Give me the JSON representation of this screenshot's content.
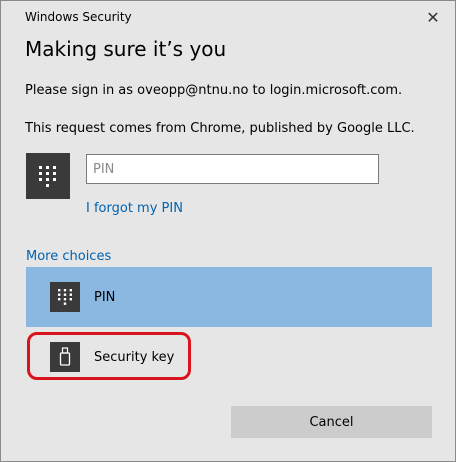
{
  "window": {
    "title": "Windows Security",
    "close_glyph": "✕"
  },
  "heading": "Making sure it’s you",
  "message": {
    "signin": "Please sign in as oveopp@ntnu.no to login.microsoft.com.",
    "request": "This request comes from Chrome, published by Google LLC."
  },
  "pin": {
    "placeholder": "PIN",
    "value": "",
    "forgot_link": "I forgot my PIN",
    "icon": "keypad-icon"
  },
  "more_choices": {
    "label": "More choices",
    "options": [
      {
        "label": "PIN",
        "icon": "keypad-icon",
        "selected": true
      },
      {
        "label": "Security key",
        "icon": "usb-key-icon",
        "selected": false,
        "highlighted": true
      }
    ]
  },
  "buttons": {
    "cancel": "Cancel"
  },
  "colors": {
    "background": "#e6e6e6",
    "selected_option": "#8ab8e0",
    "link": "#0063b1",
    "highlight": "#d8141c",
    "cancel_button": "#cccccc",
    "icon_tile": "#3a3a3a"
  }
}
